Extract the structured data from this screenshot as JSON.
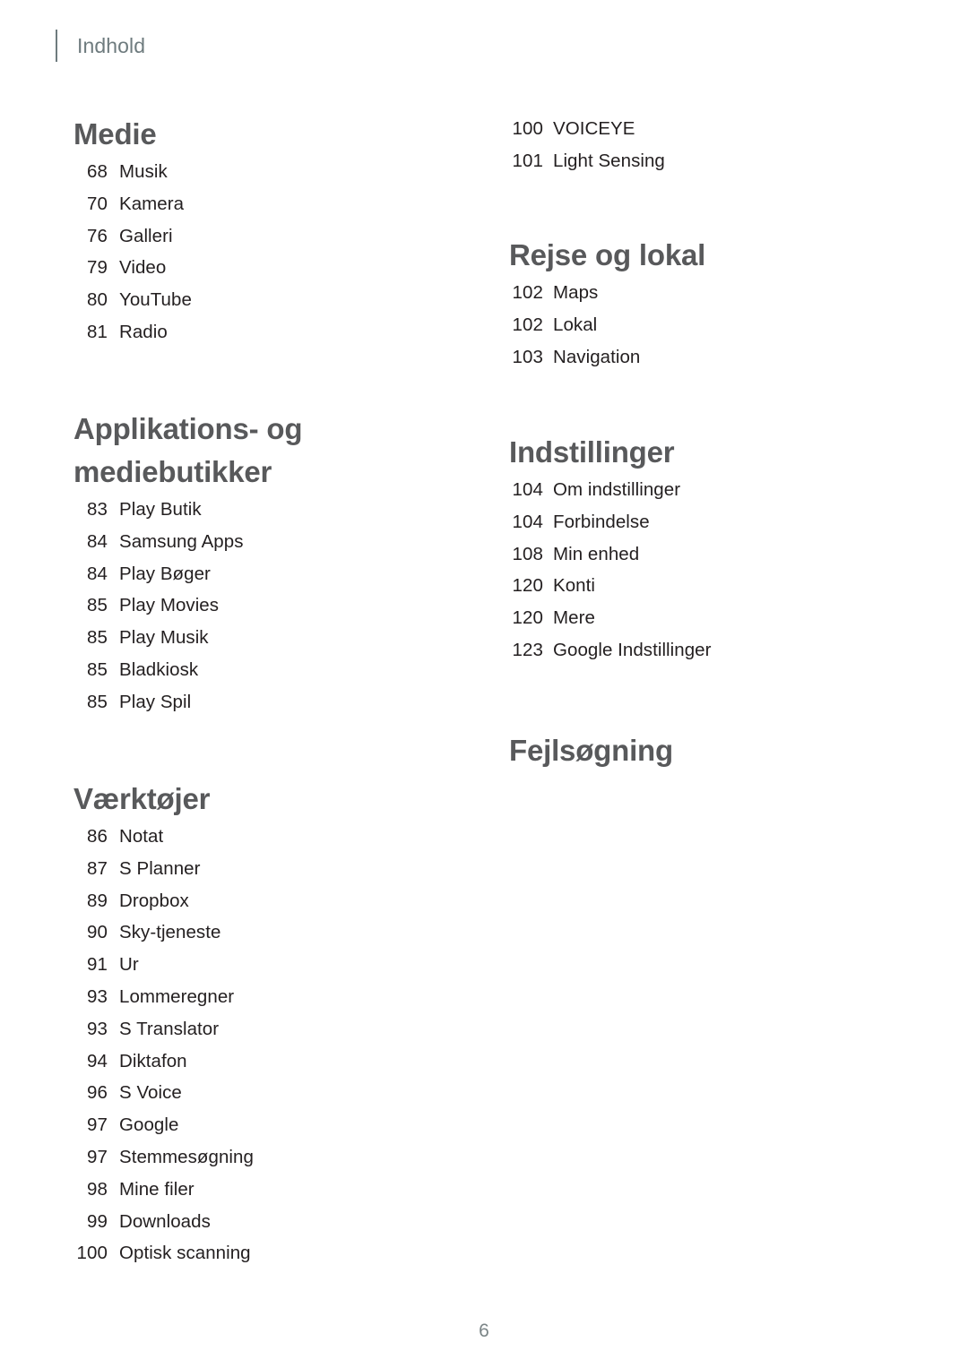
{
  "header": {
    "title": "Indhold",
    "rule_color": "#6e7b7e"
  },
  "folio": {
    "page_number": "6"
  },
  "colors": {
    "heading": "#58595b",
    "body_text": "#231f20",
    "header_text": "#6e7b7e",
    "folio_text": "#7b8587",
    "background": "#ffffff"
  },
  "left_column": {
    "sections": [
      {
        "heading": "Medie",
        "entries": [
          {
            "page": "68",
            "label": "Musik"
          },
          {
            "page": "70",
            "label": "Kamera"
          },
          {
            "page": "76",
            "label": "Galleri"
          },
          {
            "page": "79",
            "label": "Video"
          },
          {
            "page": "80",
            "label": "YouTube"
          },
          {
            "page": "81",
            "label": "Radio"
          }
        ]
      },
      {
        "heading": "Applikations- og\nmediebutikker",
        "entries": [
          {
            "page": "83",
            "label": "Play Butik"
          },
          {
            "page": "84",
            "label": "Samsung Apps"
          },
          {
            "page": "84",
            "label": "Play Bøger"
          },
          {
            "page": "85",
            "label": "Play Movies"
          },
          {
            "page": "85",
            "label": "Play Musik"
          },
          {
            "page": "85",
            "label": "Bladkiosk"
          },
          {
            "page": "85",
            "label": "Play Spil"
          }
        ]
      },
      {
        "heading": "Værktøjer",
        "entries": [
          {
            "page": "86",
            "label": "Notat"
          },
          {
            "page": "87",
            "label": "S Planner"
          },
          {
            "page": "89",
            "label": "Dropbox"
          },
          {
            "page": "90",
            "label": "Sky-tjeneste"
          },
          {
            "page": "91",
            "label": "Ur"
          },
          {
            "page": "93",
            "label": "Lommeregner"
          },
          {
            "page": "93",
            "label": "S Translator"
          },
          {
            "page": "94",
            "label": "Diktafon"
          },
          {
            "page": "96",
            "label": "S Voice"
          },
          {
            "page": "97",
            "label": "Google"
          },
          {
            "page": "97",
            "label": "Stemmesøgning"
          },
          {
            "page": "98",
            "label": "Mine filer"
          },
          {
            "page": "99",
            "label": "Downloads"
          },
          {
            "page": "100",
            "label": "Optisk scanning"
          }
        ]
      }
    ]
  },
  "right_column": {
    "sections": [
      {
        "heading": "",
        "entries": [
          {
            "page": "100",
            "label": "VOICEYE"
          },
          {
            "page": "101",
            "label": "Light Sensing"
          }
        ]
      },
      {
        "heading": "Rejse og lokal",
        "entries": [
          {
            "page": "102",
            "label": "Maps"
          },
          {
            "page": "102",
            "label": "Lokal"
          },
          {
            "page": "103",
            "label": "Navigation"
          }
        ]
      },
      {
        "heading": "Indstillinger",
        "entries": [
          {
            "page": "104",
            "label": "Om indstillinger"
          },
          {
            "page": "104",
            "label": "Forbindelse"
          },
          {
            "page": "108",
            "label": "Min enhed"
          },
          {
            "page": "120",
            "label": "Konti"
          },
          {
            "page": "120",
            "label": "Mere"
          },
          {
            "page": "123",
            "label": "Google Indstillinger"
          }
        ]
      },
      {
        "heading": "Fejlsøgning",
        "entries": []
      }
    ]
  }
}
